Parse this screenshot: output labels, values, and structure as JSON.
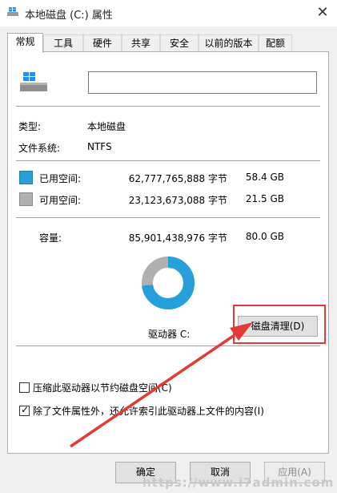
{
  "window": {
    "title": "本地磁盘 (C:) 属性",
    "close_glyph": "✕"
  },
  "tabs": [
    "常规",
    "工具",
    "硬件",
    "共享",
    "安全",
    "以前的版本",
    "配额"
  ],
  "general": {
    "type_label": "类型:",
    "type_value": "本地磁盘",
    "fs_label": "文件系统:",
    "fs_value": "NTFS",
    "used": {
      "label": "已用空间:",
      "bytes": "62,777,765,888 字节",
      "size": "58.4 GB",
      "color": "#26a0da"
    },
    "free": {
      "label": "可用空间:",
      "bytes": "23,123,673,088 字节",
      "size": "21.5 GB",
      "color": "#b0b0b0"
    },
    "capacity": {
      "label": "容量:",
      "bytes": "85,901,438,976 字节",
      "size": "80.0 GB"
    },
    "used_fraction": 0.731,
    "drive_label": "驱动器 C:",
    "cleanup_button": "磁盘清理(D)"
  },
  "options": {
    "compress": {
      "label": "压缩此驱动器以节约磁盘空间(C)",
      "checked": false
    },
    "index": {
      "label": "除了文件属性外，还允许索引此驱动器上文件的内容(I)",
      "checked": true
    }
  },
  "buttons": {
    "ok": "确定",
    "cancel": "取消",
    "apply": "应用(A)"
  },
  "watermark": "https://www.i7admin.com"
}
